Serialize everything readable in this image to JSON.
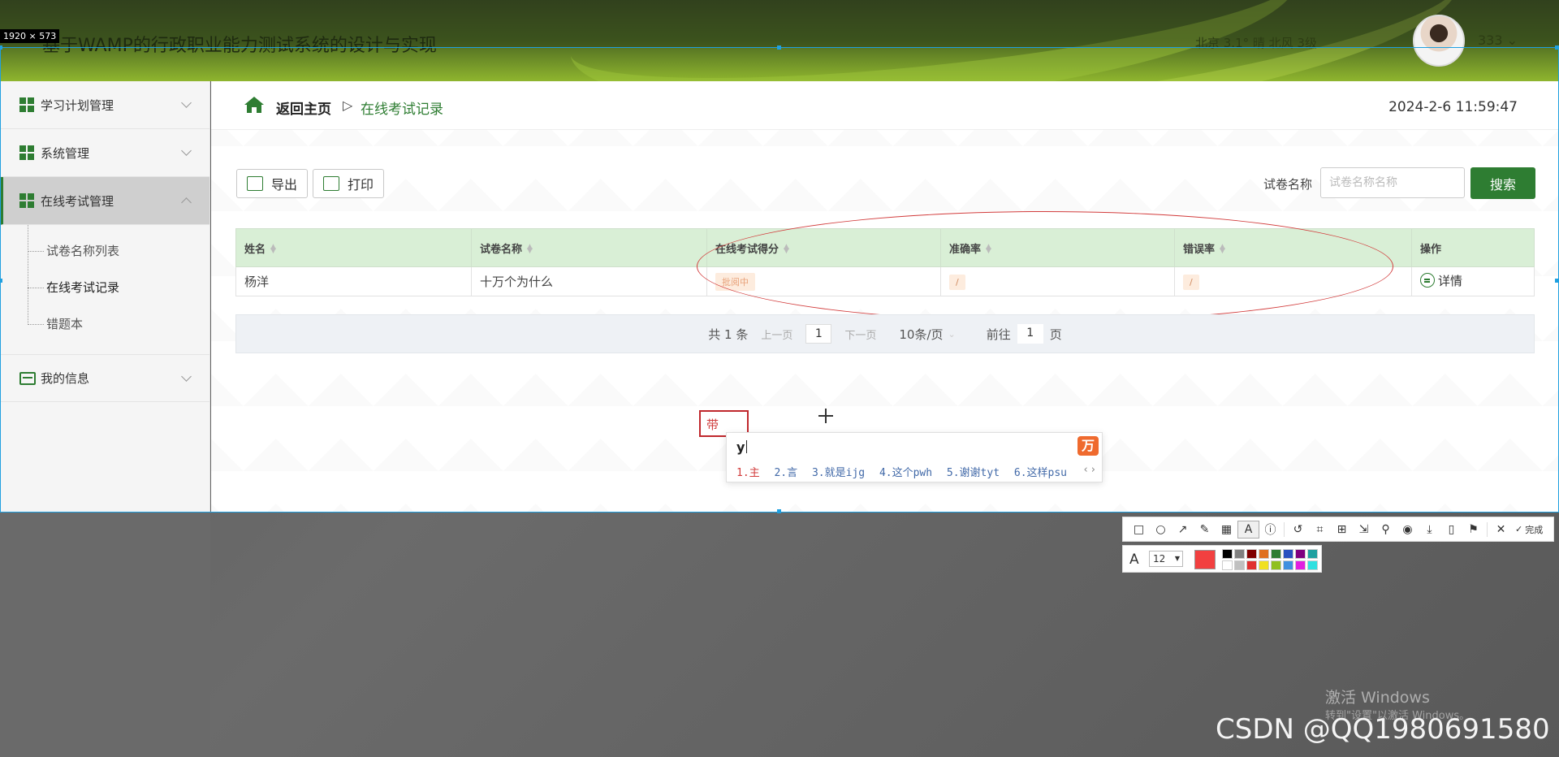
{
  "overlay": {
    "selection_size": "1920 × 573"
  },
  "header": {
    "title": "基于WAMP的行政职业能力测试系统的设计与实现",
    "weather": "北京  3.1°  晴  北风  3级",
    "user": "333 ⌄"
  },
  "sidebar": {
    "items": [
      {
        "label": "学习计划管理"
      },
      {
        "label": "系统管理"
      },
      {
        "label": "在线考试管理"
      },
      {
        "label": "我的信息"
      }
    ],
    "submenu": [
      {
        "label": "试卷名称列表"
      },
      {
        "label": "在线考试记录"
      },
      {
        "label": "错题本"
      }
    ]
  },
  "breadcrumb": {
    "home": "返回主页",
    "separator": "▷",
    "current": "在线考试记录"
  },
  "clock": "2024-2-6 11:59:47",
  "toolbar": {
    "export_label": "导出",
    "print_label": "打印"
  },
  "search": {
    "label": "试卷名称",
    "placeholder": "试卷名称名称",
    "button": "搜索"
  },
  "table": {
    "headers": [
      "姓名",
      "试卷名称",
      "在线考试得分",
      "准确率",
      "错误率",
      "操作"
    ],
    "rows": [
      {
        "name": "杨洋",
        "paper": "十万个为什么",
        "score": "批阅中",
        "accuracy": "/",
        "error_rate": "/",
        "action": "详情"
      }
    ]
  },
  "pager": {
    "total": "共 1 条",
    "prev": "上一页",
    "page": "1",
    "next": "下一页",
    "page_size": "10条/页",
    "goto_prefix": "前往",
    "goto_value": "1",
    "goto_suffix": "页"
  },
  "annotation": {
    "text": "带"
  },
  "ime": {
    "input": "y",
    "logo": "万",
    "candidates": [
      "1.主",
      "2.言",
      "3.就是ijg",
      "4.这个pwh",
      "5.谢谢tyt",
      "6.这样psu"
    ],
    "arrows": "‹ ›"
  },
  "snip_toolbar": {
    "done": "完成",
    "font_size": "12",
    "current_color": "#f24040",
    "palette": [
      "#000000",
      "#808080",
      "#800000",
      "#e07020",
      "#2e7d32",
      "#2850c0",
      "#800080",
      "#20a0a0",
      "#ffffff",
      "#c0c0c0",
      "#e03030",
      "#f0e020",
      "#90c020",
      "#4090e0",
      "#e020e0",
      "#30e0e0"
    ]
  },
  "watermarks": {
    "windows_line1": "激活 Windows",
    "windows_line2": "转到\"设置\"以激活 Windows。",
    "csdn": "CSDN @QQ1980691580"
  },
  "colors": {
    "accent": "#2e7d32",
    "header_green": "#8fb52e",
    "table_header": "#d9efd6",
    "annotation_red": "#d23c3c"
  }
}
